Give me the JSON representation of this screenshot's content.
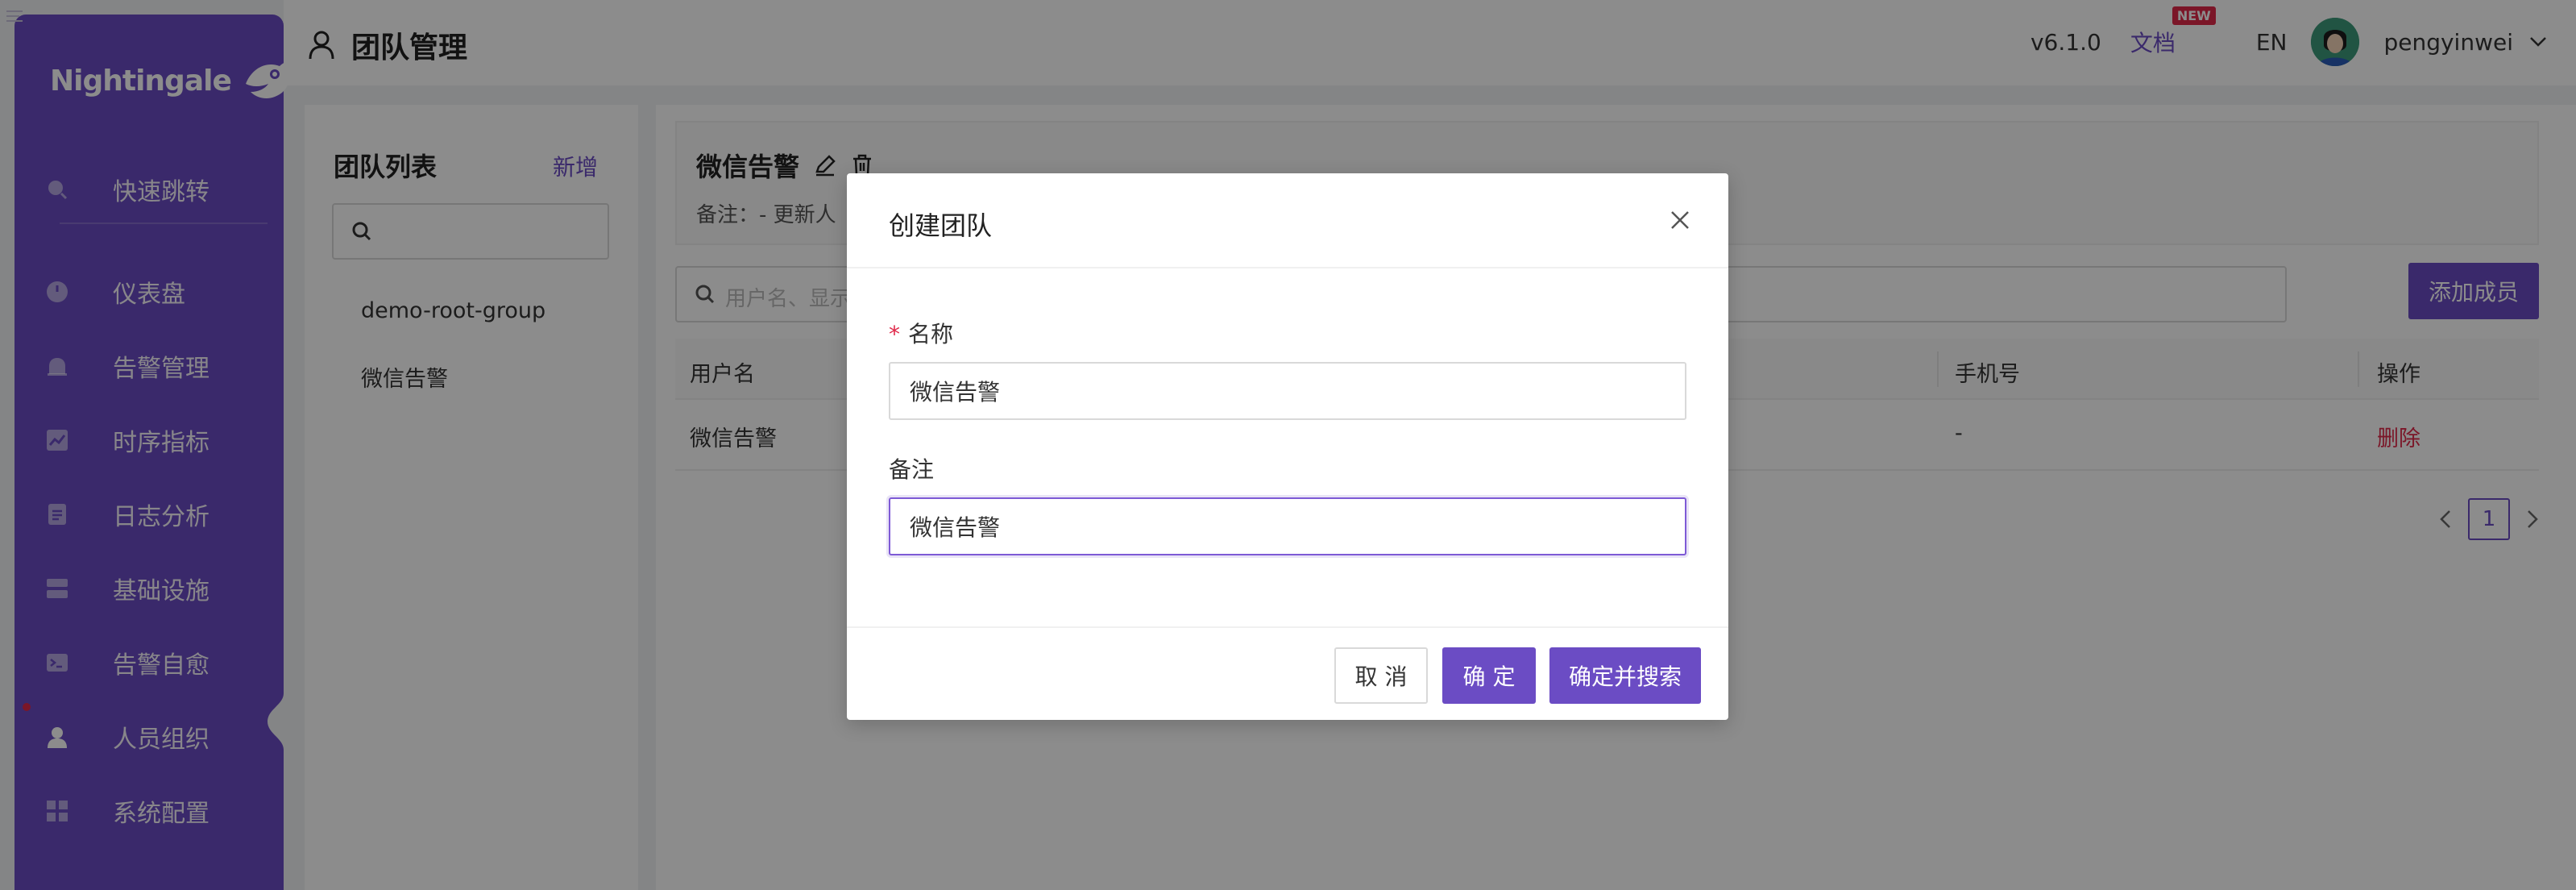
{
  "sidebar": {
    "logo_text": "Nightingale",
    "items": [
      {
        "label": "快速跳转",
        "icon": "search-icon"
      },
      {
        "label": "仪表盘",
        "icon": "dashboard-icon"
      },
      {
        "label": "告警管理",
        "icon": "alarm-bell-icon"
      },
      {
        "label": "时序指标",
        "icon": "line-chart-icon"
      },
      {
        "label": "日志分析",
        "icon": "log-file-icon"
      },
      {
        "label": "基础设施",
        "icon": "server-icon"
      },
      {
        "label": "告警自愈",
        "icon": "terminal-icon"
      },
      {
        "label": "人员组织",
        "icon": "user-icon"
      },
      {
        "label": "系统配置",
        "icon": "settings-grid-icon"
      }
    ],
    "active": "人员组织"
  },
  "header": {
    "title": "团队管理",
    "version": "v6.1.0",
    "docs": "文档",
    "new_badge": "NEW",
    "lang": "EN",
    "username": "pengyinwei"
  },
  "team_panel": {
    "title": "团队列表",
    "add_label": "新增",
    "search_placeholder": "",
    "teams": [
      "demo-root-group",
      "微信告警"
    ]
  },
  "detail": {
    "name": "微信告警",
    "note": "备注：-   更新人"
  },
  "members": {
    "search_placeholder": "用户名、显示",
    "add_button": "添加成员",
    "columns": [
      "用户名",
      "手机号",
      "操作"
    ],
    "rows": [
      {
        "username": "微信告警",
        "phone": "-",
        "action": "删除"
      }
    ],
    "current_page": "1"
  },
  "modal": {
    "title": "创建团队",
    "name_label": "名称",
    "name_value": "微信告警",
    "note_label": "备注",
    "note_value": "微信告警",
    "cancel_label": "取 消",
    "ok_label": "确 定",
    "ok_search_label": "确定并搜索"
  },
  "colors": {
    "primary": "#6b4cc4",
    "danger": "#e0294a"
  }
}
